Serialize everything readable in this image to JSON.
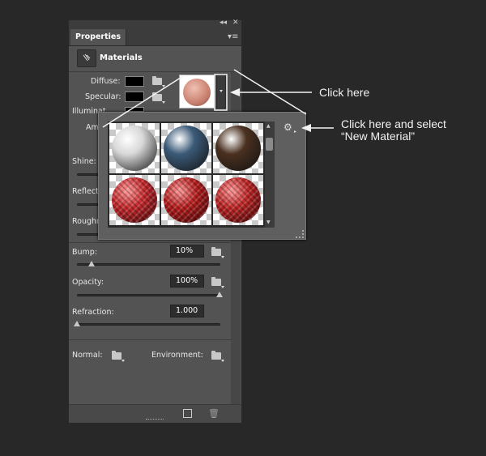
{
  "panel": {
    "tab_label": "Properties",
    "header_label": "Materials",
    "diffuse_label": "Diffuse:",
    "specular_label": "Specular:",
    "illumination_label": "Illuminat",
    "ambient_label": "Aml",
    "shine_label": "Shine:",
    "reflection_label": "Reflecti",
    "roughness_label": "Roughn",
    "bump_label": "Bump:",
    "bump_value": "10%",
    "opacity_label": "Opacity:",
    "opacity_value": "100%",
    "refraction_label": "Refraction:",
    "refraction_value": "1.000",
    "normal_label": "Normal:",
    "environment_label": "Environment:"
  },
  "picker": {
    "materials": [
      {
        "name": "white-matte",
        "color": "#d8d8d8"
      },
      {
        "name": "blue-metal",
        "color": "#3b5a78"
      },
      {
        "name": "dark-wood",
        "color": "#4a3020"
      },
      {
        "name": "red-fabric-dots",
        "color": "#c8282c"
      },
      {
        "name": "red-fabric-weave",
        "color": "#b81c1c"
      },
      {
        "name": "red-plaid",
        "color": "#c02424"
      }
    ]
  },
  "annotations": {
    "click_here": "Click here",
    "new_material_line1": "Click here and select",
    "new_material_line2": "“New Material”"
  },
  "colors": {
    "panel_bg": "#535353",
    "page_bg": "#282828"
  }
}
